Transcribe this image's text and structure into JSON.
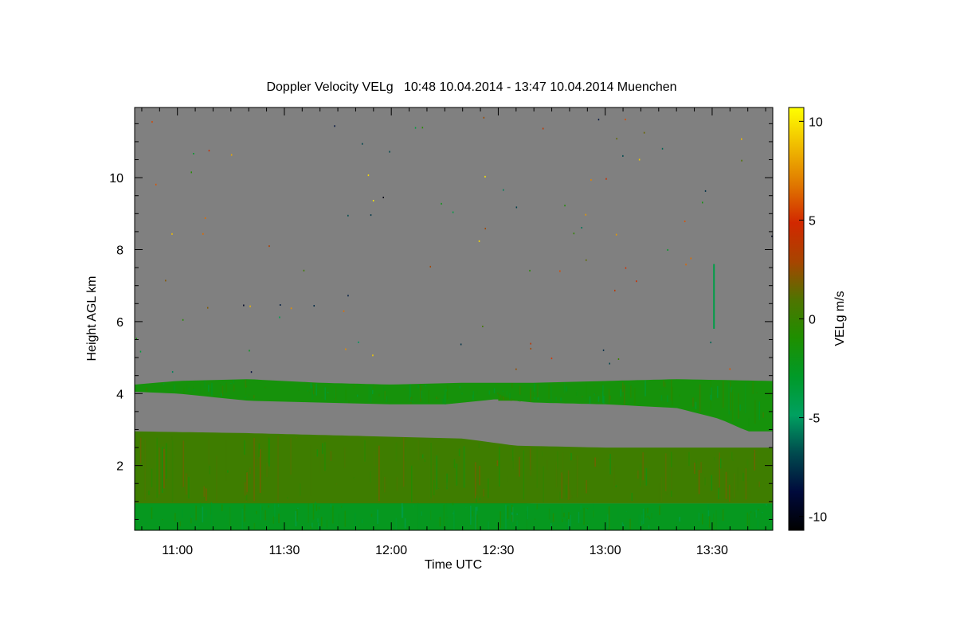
{
  "chart_data": {
    "type": "heatmap",
    "title": "Doppler Velocity VELg   10:48 10.04.2014 - 13:47 10.04.2014 Muenchen",
    "xlabel": "Time UTC",
    "ylabel": "Height AGL km",
    "colorbar_label": "VELg m/s",
    "x_range_minutes_utc": [
      648,
      827
    ],
    "y_range_km": [
      0.2,
      11.95
    ],
    "x_ticks": [
      {
        "minute": 660,
        "label": "11:00"
      },
      {
        "minute": 690,
        "label": "11:30"
      },
      {
        "minute": 720,
        "label": "12:00"
      },
      {
        "minute": 750,
        "label": "12:30"
      },
      {
        "minute": 780,
        "label": "13:00"
      },
      {
        "minute": 810,
        "label": "13:30"
      }
    ],
    "y_ticks": [
      {
        "value": 2,
        "label": "2"
      },
      {
        "value": 4,
        "label": "4"
      },
      {
        "value": 6,
        "label": "6"
      },
      {
        "value": 8,
        "label": "8"
      },
      {
        "value": 10,
        "label": "10"
      }
    ],
    "colorbar_range": [
      -10.7,
      10.7
    ],
    "colorbar_ticks": [
      {
        "value": 10,
        "label": "10"
      },
      {
        "value": 5,
        "label": "5"
      },
      {
        "value": 0,
        "label": "0"
      },
      {
        "value": -5,
        "label": "-5"
      },
      {
        "value": -10,
        "label": "-10"
      }
    ],
    "colormap": [
      "#000000",
      "#000a3c",
      "#004a4e",
      "#00a060",
      "#009a28",
      "#1e8f00",
      "#4f7400",
      "#a84400",
      "#d22800",
      "#e07800",
      "#f0bc00",
      "#ffff00"
    ],
    "background_color": "#808080",
    "layers": [
      {
        "name": "boundary-layer-lower",
        "top_km": [
          [
            648,
            0.95
          ],
          [
            680,
            1.0
          ],
          [
            720,
            1.0
          ],
          [
            760,
            0.95
          ],
          [
            800,
            0.95
          ],
          [
            827,
            0.95
          ]
        ],
        "bottom_km": 0.2,
        "velocity_ms": -2.5
      },
      {
        "name": "boundary-layer-upper",
        "top_km": [
          [
            648,
            2.95
          ],
          [
            680,
            2.9
          ],
          [
            720,
            2.8
          ],
          [
            740,
            2.75
          ],
          [
            755,
            2.55
          ],
          [
            780,
            2.5
          ],
          [
            827,
            2.5
          ]
        ],
        "bottom_km": [
          [
            648,
            0.95
          ],
          [
            827,
            0.95
          ]
        ],
        "velocity_ms": 0.3
      },
      {
        "name": "cloud-layer-4km",
        "top_km": [
          [
            648,
            4.25
          ],
          [
            660,
            4.35
          ],
          [
            680,
            4.4
          ],
          [
            700,
            4.3
          ],
          [
            720,
            4.25
          ],
          [
            740,
            4.3
          ],
          [
            760,
            4.3
          ],
          [
            780,
            4.35
          ],
          [
            800,
            4.4
          ],
          [
            827,
            4.35
          ]
        ],
        "bottom_km": [
          [
            648,
            4.05
          ],
          [
            660,
            4.0
          ],
          [
            680,
            3.8
          ],
          [
            700,
            3.75
          ],
          [
            720,
            3.7
          ],
          [
            735,
            3.7
          ],
          [
            750,
            3.85
          ],
          [
            760,
            3.75
          ],
          [
            780,
            3.7
          ],
          [
            800,
            3.6
          ],
          [
            812,
            3.3
          ],
          [
            820,
            2.95
          ],
          [
            827,
            2.95
          ]
        ],
        "velocity_ms": -1.5
      },
      {
        "name": "virga-wedge",
        "top_km": [
          [
            750,
            4.0
          ],
          [
            752,
            3.9
          ],
          [
            756,
            3.8
          ]
        ],
        "bottom_km": [
          [
            745,
            3.95
          ],
          [
            750,
            3.8
          ],
          [
            756,
            3.8
          ]
        ],
        "velocity_ms": -1.0
      }
    ],
    "streak": {
      "minute": 810.5,
      "top_km": 7.6,
      "bottom_km": 5.8,
      "velocity_ms": -4.0
    },
    "speckle_count": 90
  }
}
